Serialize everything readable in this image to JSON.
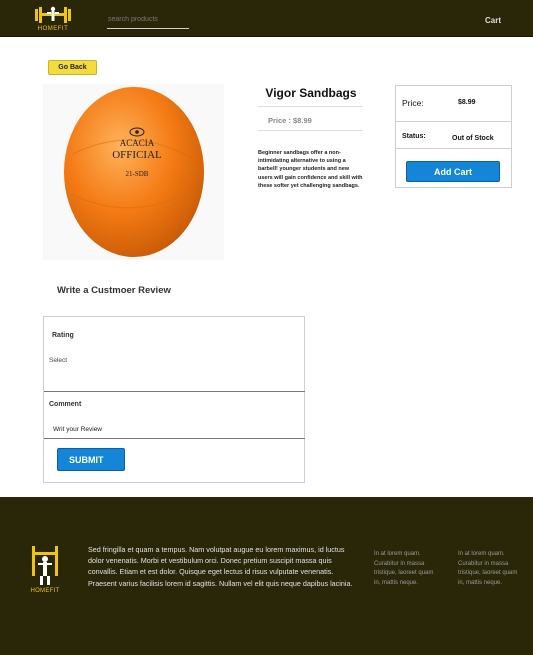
{
  "header": {
    "logo_text": "HOMEFIT",
    "search_placeholder": "search products",
    "cart_label": "Cart"
  },
  "product": {
    "back_label": "Go Back",
    "image_text": {
      "line1": "ACACIA",
      "line2": "OFFICIAL",
      "line3": "21-SDB"
    },
    "title": "Vigor Sandbags",
    "price_text": "Price : $8.99",
    "description": "Beginner sandbags offer a non-intimidating alternative to using a barbell! younger students and new users will gain confidence and skill with these softer yet challenging sandbags."
  },
  "buy_box": {
    "price_label": "Price:",
    "price_value": "$8.99",
    "status_label": "Status:",
    "status_value": "Out of Stock",
    "add_cart_label": "Add Cart"
  },
  "review": {
    "title": "Write a Custmoer Review",
    "rating_label": "Rating",
    "rating_selected": "Select",
    "comment_label": "Comment",
    "comment_placeholder": "Writ your Review",
    "submit_label": "SUBMIT"
  },
  "footer": {
    "logo_text": "HOMEFIT",
    "text": "Sed fringilla et quam a tempus. Nam volutpat augue eu lorem maximus, id luctus dolor venenatis. Morbi et vestibulum orci. Donec pretium suscipit massa quis convallis. Etiam et est dolor. Quisque eget lectus id risus vulputate venenatis. Praesent varius facilisis lorem id sagittis. Nullam vel elit quis neque dapibus lacinia.",
    "col1": "In at lorem quam. Curabitur in massa tristique, laoreet quam in, mattis neque.",
    "col2": "In at lorem quam. Curabitur in massa tristique, laoreet quam in, mattis neque."
  },
  "colors": {
    "header_bg": "#2a2709",
    "brand_yellow": "#f1c40f",
    "button_blue": "#1585d8",
    "go_back_yellow": "#f3dc3b",
    "product_orange": "#f47a14"
  }
}
